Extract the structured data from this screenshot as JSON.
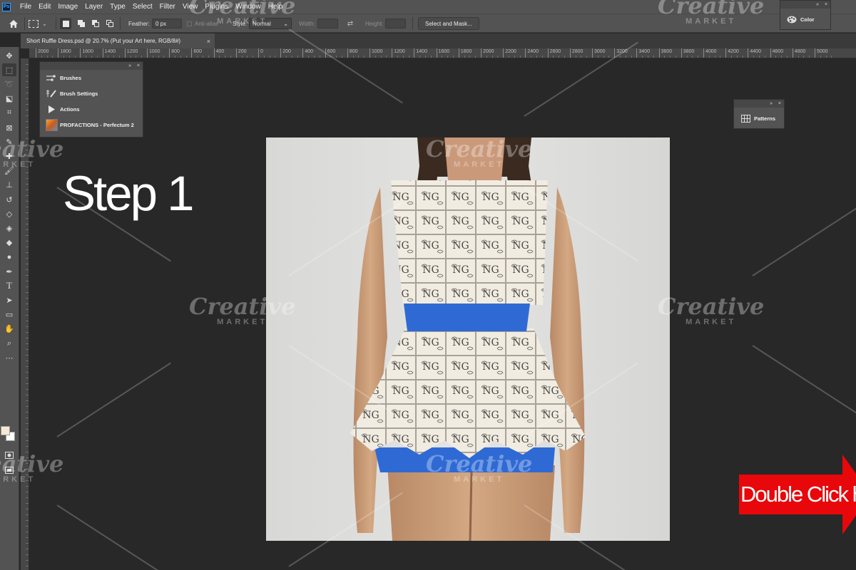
{
  "app": {
    "logo_text": "Ps"
  },
  "menu": [
    "File",
    "Edit",
    "Image",
    "Layer",
    "Type",
    "Select",
    "Filter",
    "View",
    "Plugins",
    "Window",
    "Help"
  ],
  "options_bar": {
    "feather_label": "Feather:",
    "feather_value": "0 px",
    "anti_alias_label": "Anti-alias",
    "style_label": "Style:",
    "style_value": "Normal",
    "width_label": "Width:",
    "height_label": "Height:",
    "select_mask_label": "Select and Mask..."
  },
  "document_tab": {
    "title": "Short Ruffle Dress.psd @ 20.7% (Put your Art here, RGB/8#)",
    "close": "×"
  },
  "ruler_ticks": [
    "2000",
    "1800",
    "1600",
    "1400",
    "1200",
    "1000",
    "800",
    "600",
    "400",
    "200",
    "0",
    "200",
    "400",
    "600",
    "800",
    "1000",
    "1200",
    "1400",
    "1600",
    "1800",
    "2000",
    "2200",
    "2400",
    "2600",
    "2800",
    "3000",
    "3200",
    "3400",
    "3600",
    "3800",
    "4000",
    "4200",
    "4400",
    "4600",
    "4800",
    "5000"
  ],
  "panels": {
    "left_group": [
      {
        "icon": "brushes-icon",
        "label": "Brushes"
      },
      {
        "icon": "brush-settings-icon",
        "label": "Brush Settings"
      },
      {
        "icon": "actions-play-icon",
        "label": "Actions"
      },
      {
        "icon": "profactions-thumbnail",
        "label": "PROFACTIONS - Perfectum 2"
      }
    ],
    "color": {
      "icon": "color-palette-icon",
      "label": "Color"
    },
    "patterns": {
      "icon": "patterns-grid-icon",
      "label": "Patterns"
    }
  },
  "overlay": {
    "step_title": "Step 1",
    "banner_text": "Double Click here"
  },
  "watermark": {
    "brand": "Creative",
    "sub": "MARKET"
  },
  "colors": {
    "foreground_swatch": "#f6e8d4",
    "background_swatch": "#ffffff",
    "banner": "#e8070a",
    "dress_belt": "#2f6ad4",
    "workspace": "#282828",
    "panel": "#535353"
  },
  "tools": [
    "move-tool",
    "rect-marquee-tool",
    "lasso-tool",
    "object-select-tool",
    "crop-tool",
    "frame-tool",
    "eyedropper-tool",
    "healing-brush-tool",
    "brush-tool",
    "clone-stamp-tool",
    "history-brush-tool",
    "eraser-tool",
    "paint-bucket-tool",
    "blur-tool",
    "dodge-tool",
    "pen-tool",
    "type-tool",
    "path-select-tool",
    "rectangle-tool",
    "hand-tool",
    "zoom-tool",
    "more-tools"
  ]
}
